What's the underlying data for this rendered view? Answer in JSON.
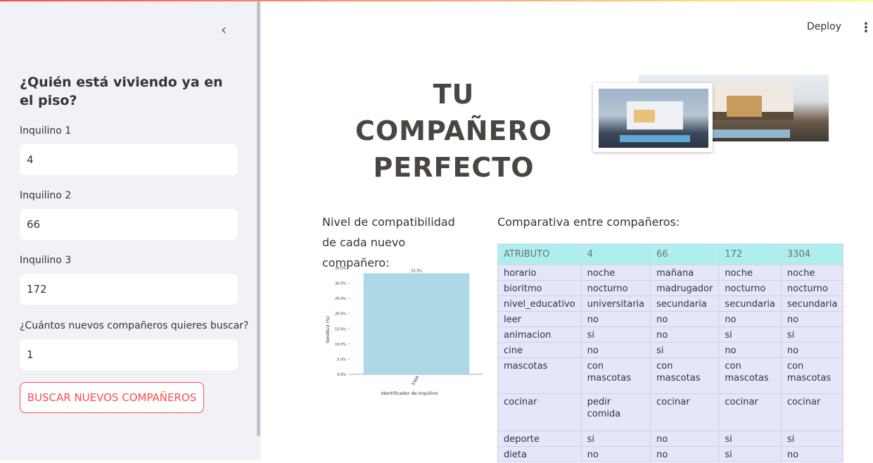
{
  "app": {
    "deploy_label": "Deploy",
    "menu_icon": "more-vert-icon"
  },
  "sidebar": {
    "collapse_icon": "chevron-left-icon",
    "title": "¿Quién está viviendo ya en el piso?",
    "fields": [
      {
        "label": "Inquilino 1",
        "value": "4"
      },
      {
        "label": "Inquilino 2",
        "value": "66"
      },
      {
        "label": "Inquilino 3",
        "value": "172"
      },
      {
        "label": "¿Cuántos nuevos compañeros quieres buscar?",
        "value": "1"
      }
    ],
    "button_label": "BUSCAR NUEVOS COMPAÑEROS"
  },
  "main": {
    "hero_line1": "TU COMPAÑERO",
    "hero_line2": "PERFECTO",
    "compat_heading": "Nivel de compatibilidad de cada nuevo compañero:",
    "table_heading": "Comparativa entre compañeros:",
    "table": {
      "headers": [
        "ATRIBUTO",
        "4",
        "66",
        "172",
        "3304"
      ],
      "rows": [
        [
          "horario",
          "noche",
          "mañana",
          "noche",
          "noche"
        ],
        [
          "bioritmo",
          "nocturno",
          "madrugador",
          "nocturno",
          "nocturno"
        ],
        [
          "nivel_educativo",
          "universitaria",
          "secundaria",
          "secundaria",
          "secundaria"
        ],
        [
          "leer",
          "no",
          "no",
          "no",
          "no"
        ],
        [
          "animacion",
          "si",
          "no",
          "si",
          "si"
        ],
        [
          "cine",
          "no",
          "si",
          "no",
          "no"
        ],
        [
          "mascotas",
          "con mascotas",
          "con mascotas",
          "con mascotas",
          "con mascotas"
        ],
        [
          "cocinar",
          "pedir comida",
          "cocinar",
          "cocinar",
          "cocinar"
        ],
        [
          "deporte",
          "si",
          "no",
          "si",
          "si"
        ],
        [
          "dieta",
          "no",
          "no",
          "si",
          "no"
        ]
      ]
    }
  },
  "chart_data": {
    "type": "bar",
    "categories": [
      "3304"
    ],
    "values": [
      33.3
    ],
    "value_labels": [
      "33.3%"
    ],
    "xlabel": "Identificador de Inquilino",
    "ylabel": "Similitud (%)",
    "ylim": [
      0,
      35
    ],
    "yticks": [
      "0.0%",
      "5.0%",
      "10.0%",
      "15.0%",
      "20.0%",
      "25.0%",
      "30.0%",
      "35.0%"
    ],
    "bar_color": "#add8e6"
  }
}
